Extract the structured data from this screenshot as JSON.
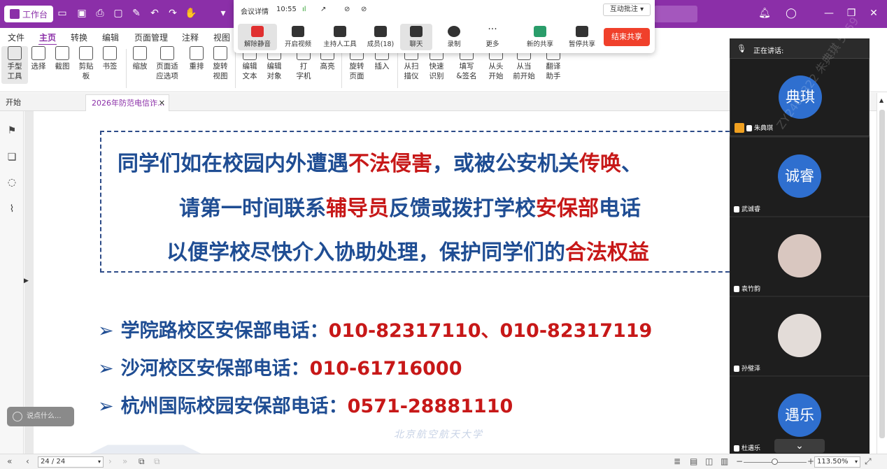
{
  "titlebar": {
    "app_label": "工作台"
  },
  "menu": [
    "文件",
    "主页",
    "转换",
    "编辑",
    "页面管理",
    "注释",
    "视图"
  ],
  "ribbon": [
    {
      "label": "手型\n工具"
    },
    {
      "label": "选择"
    },
    {
      "label": "截图"
    },
    {
      "label": "剪贴\n板"
    },
    {
      "label": "书签"
    },
    {
      "label": "缩放"
    },
    {
      "label": "页面适\n应选项"
    },
    {
      "label": "重排"
    },
    {
      "label": "旋转\n视图"
    },
    {
      "label": "编辑\n文本"
    },
    {
      "label": "编辑\n对象"
    },
    {
      "label": "打\n字机"
    },
    {
      "label": "高亮"
    },
    {
      "label": "旋转\n页面"
    },
    {
      "label": "插入"
    },
    {
      "label": "从扫\n描仪"
    },
    {
      "label": "快速\n识别"
    },
    {
      "label": "填写\n&签名"
    },
    {
      "label": "从头\n开始"
    },
    {
      "label": "从当\n前开始"
    },
    {
      "label": "翻译\n助手"
    }
  ],
  "meeting": {
    "title": "会议详情",
    "time": "10:55",
    "interact": "互动批注",
    "buttons": [
      "解除静音",
      "开启视频",
      "主持人工具",
      "成员(18)",
      "聊天",
      "录制",
      "更多",
      "新的共享",
      "暂停共享"
    ],
    "end_share": "结束共享"
  },
  "tabs": {
    "home": "开始",
    "doc": "2026年防范电信诈..."
  },
  "slide": {
    "line1": {
      "a": "同学们如在校园内外遭遇",
      "b": "不法侵害",
      "c": "，或被公安机关",
      "d": "传唤",
      "e": "、"
    },
    "line2": {
      "a": "请第一时间联系",
      "b": "辅导员",
      "c": "反馈或拨打学校",
      "d": "安保部",
      "e": "电话"
    },
    "line3": {
      "a": "以便学校尽快介入协助处理，保护同学们的",
      "b": "合法权益"
    },
    "phones": [
      {
        "label": "学院路校区安保部电话：",
        "number": "010-82317110、010-82317119"
      },
      {
        "label": "沙河校区安保部电话：",
        "number": "010-61716000"
      },
      {
        "label": "杭州国际校园安保部电话：",
        "number": "0571-28881110"
      }
    ],
    "watermark": "北京航空航天大学"
  },
  "chat_placeholder": "说点什么...",
  "panel": {
    "speaking_label": "正在讲话:",
    "watermark": "ZY2408322 朱典琪 5559",
    "participants": [
      {
        "avatar": "典琪",
        "name": "朱典琪"
      },
      {
        "avatar": "诚睿",
        "name": "武诚睿"
      },
      {
        "avatar": "",
        "name": "袁竹韵"
      },
      {
        "avatar": "",
        "name": "孙璧泽"
      },
      {
        "avatar": "遇乐",
        "name": "杜遇乐"
      }
    ]
  },
  "status": {
    "page": "24 / 24",
    "zoom": "113.50%"
  }
}
